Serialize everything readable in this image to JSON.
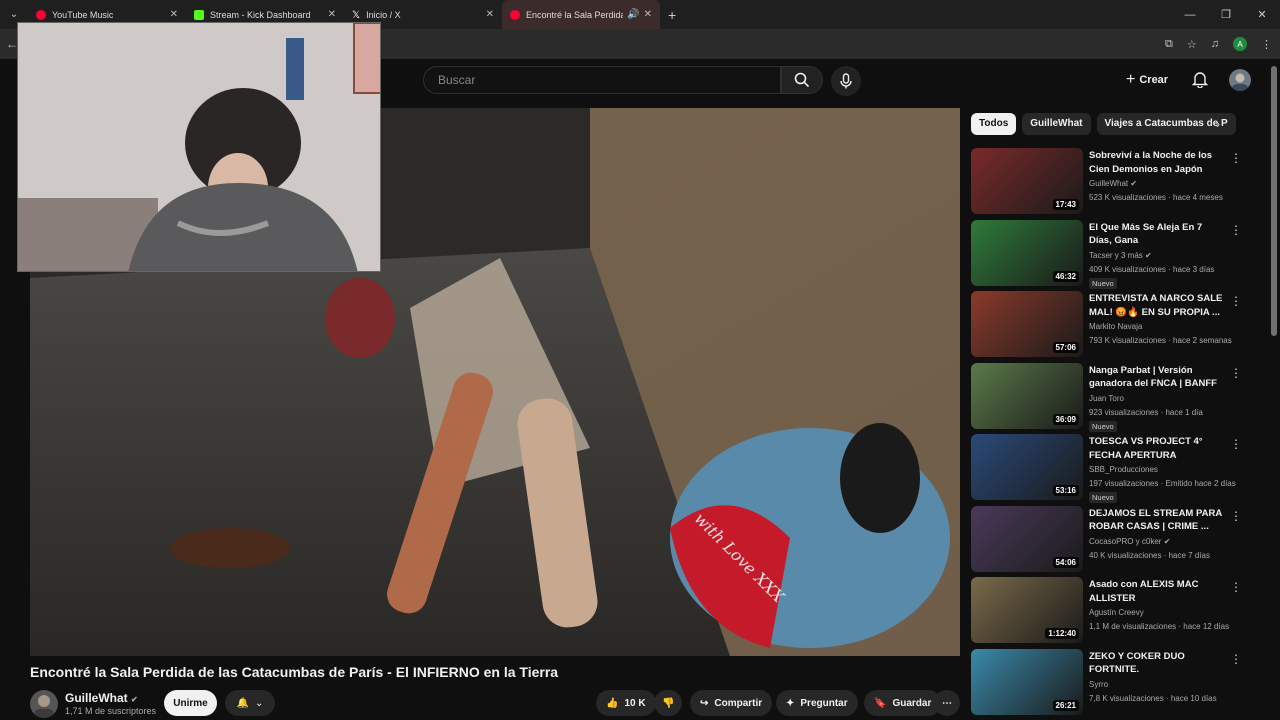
{
  "browser": {
    "tabs": [
      {
        "title": "YouTube Music",
        "color": "#ff0033"
      },
      {
        "title": "Stream - Kick Dashboard",
        "color": "#53fc18"
      },
      {
        "title": "Inicio / X",
        "color": "#ffffff"
      },
      {
        "title": "Encontré la Sala Perdida de",
        "color": "#ff0033",
        "active": true
      }
    ],
    "profile_letter": "A"
  },
  "header": {
    "search_placeholder": "Buscar",
    "create_label": "Crear"
  },
  "video": {
    "title": "Encontré la Sala Perdida de las Catacumbas de París - El INFIERNO en la Tierra",
    "channel": "GuilleWhat",
    "subscribers": "1,71 M de suscriptores",
    "join_label": "Unirme",
    "likes": "10 K",
    "share_label": "Compartir",
    "ask_label": "Preguntar",
    "save_label": "Guardar",
    "overlay_text": "with Love XXX"
  },
  "chips": [
    "Todos",
    "GuilleWhat",
    "Viajes a Catacumbas de P"
  ],
  "recommendations": [
    {
      "title": "Sobreviví a la Noche de los Cien Demonios en Japón",
      "channel": "GuilleWhat",
      "verified": true,
      "meta": "523 K visualizaciones · hace 4 meses",
      "duration": "17:43",
      "badge": "",
      "thumb": "#7a2a2a"
    },
    {
      "title": "El Que Más Se Aleja En 7 Días, Gana",
      "channel": "Tacser  y 3 más",
      "verified": true,
      "meta": "409 K visualizaciones · hace 3 días",
      "duration": "46:32",
      "badge": "Nuevo",
      "thumb": "#2f7a3a"
    },
    {
      "title": "ENTREVISTA A NARCO SALE MAL! 😡🔥 EN SU PROPIA ...",
      "channel": "Markito Navaja",
      "verified": false,
      "meta": "793 K visualizaciones · hace 2 semanas",
      "duration": "57:06",
      "badge": "",
      "thumb": "#8a3a2a"
    },
    {
      "title": "Nanga Parbat | Versión ganadora del FNCA | BANFF ...",
      "channel": "Juan Toro",
      "verified": false,
      "meta": "923 visualizaciones · hace 1 día",
      "duration": "36:09",
      "badge": "Nuevo",
      "thumb": "#5b7a4a"
    },
    {
      "title": "TOESCA VS PROJECT 4° FECHA APERTURA",
      "channel": "SBB_Producciones",
      "verified": false,
      "meta": "197 visualizaciones · Emitido hace 2 días",
      "duration": "53:16",
      "badge": "Nuevo",
      "thumb": "#2a4a7a"
    },
    {
      "title": "DEJAMOS EL STREAM PARA ROBAR CASAS | CRIME ...",
      "channel": "CocasoPRO y c0ker",
      "verified": true,
      "meta": "40 K visualizaciones · hace 7 días",
      "duration": "54:06",
      "badge": "",
      "thumb": "#4a3a5a"
    },
    {
      "title": "Asado con ALEXIS MAC ALLISTER",
      "channel": "Agustín Creevy",
      "verified": false,
      "meta": "1,1 M de visualizaciones · hace 12 días",
      "duration": "1:12:40",
      "badge": "",
      "thumb": "#7a6a4a"
    },
    {
      "title": "ZEKO Y COKER DUO FORTNITE.",
      "channel": "Syrro",
      "verified": false,
      "meta": "7,8 K visualizaciones · hace 10 días",
      "duration": "26:21",
      "badge": "",
      "thumb": "#3a8aaa"
    }
  ],
  "colors": {
    "accent": "#ff0033",
    "bg": "#0f0f0f",
    "chip_bg": "#272727"
  }
}
